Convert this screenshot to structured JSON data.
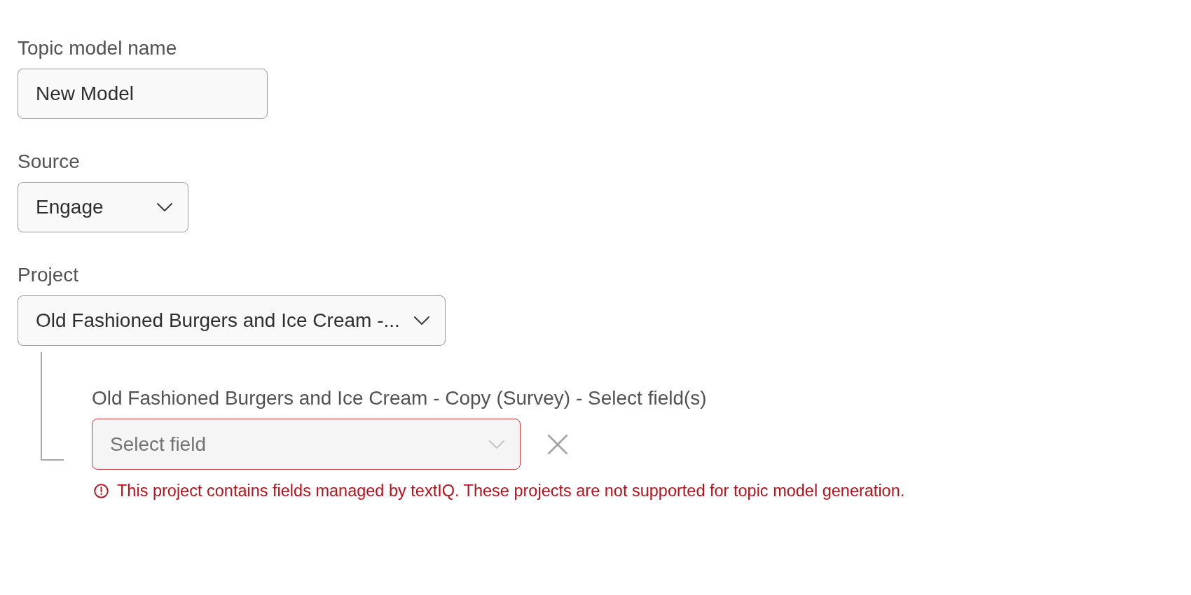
{
  "fields": [
    {
      "kind": "text",
      "label": "Topic model name",
      "value": "New Model"
    },
    {
      "kind": "select",
      "label": "Source",
      "value": "Engage"
    },
    {
      "kind": "select",
      "label": "Project",
      "value": "Old Fashioned Burgers and Ice Cream -..."
    }
  ],
  "subfield": {
    "label": "Old Fashioned Burgers and Ice Cream - Copy (Survey) - Select field(s)",
    "placeholder": "Select field",
    "invalid": true,
    "error": "This project contains fields managed by textIQ. These projects are not supported for topic model generation."
  }
}
